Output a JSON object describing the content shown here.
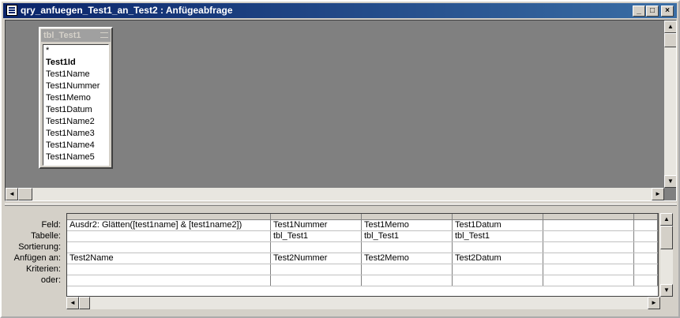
{
  "window": {
    "title": "qry_anfuegen_Test1_an_Test2 : Anfügeabfrage"
  },
  "title_buttons": {
    "minimize": "_",
    "maximize": "□",
    "close": "×"
  },
  "field_list": {
    "table_name": "tbl_Test1",
    "fields": [
      {
        "name": "*",
        "key": false
      },
      {
        "name": "Test1Id",
        "key": true
      },
      {
        "name": "Test1Name",
        "key": false
      },
      {
        "name": "Test1Nummer",
        "key": false
      },
      {
        "name": "Test1Memo",
        "key": false
      },
      {
        "name": "Test1Datum",
        "key": false
      },
      {
        "name": "Test1Name2",
        "key": false
      },
      {
        "name": "Test1Name3",
        "key": false
      },
      {
        "name": "Test1Name4",
        "key": false
      },
      {
        "name": "Test1Name5",
        "key": false
      }
    ]
  },
  "design_grid": {
    "row_labels": [
      "Feld:",
      "Tabelle:",
      "Sortierung:",
      "Anfügen an:",
      "Kriterien:",
      "oder:"
    ],
    "columns": [
      {
        "feld": "Ausdr2: Glätten([test1name] & [test1name2])",
        "tabelle": "",
        "sortierung": "",
        "anfuegen_an": "Test2Name",
        "kriterien": "",
        "oder": ""
      },
      {
        "feld": "Test1Nummer",
        "tabelle": "tbl_Test1",
        "sortierung": "",
        "anfuegen_an": "Test2Nummer",
        "kriterien": "",
        "oder": ""
      },
      {
        "feld": "Test1Memo",
        "tabelle": "tbl_Test1",
        "sortierung": "",
        "anfuegen_an": "Test2Memo",
        "kriterien": "",
        "oder": ""
      },
      {
        "feld": "Test1Datum",
        "tabelle": "tbl_Test1",
        "sortierung": "",
        "anfuegen_an": "Test2Datum",
        "kriterien": "",
        "oder": ""
      },
      {
        "feld": "",
        "tabelle": "",
        "sortierung": "",
        "anfuegen_an": "",
        "kriterien": "",
        "oder": ""
      },
      {
        "feld": "",
        "tabelle": "",
        "sortierung": "",
        "anfuegen_an": "",
        "kriterien": "",
        "oder": ""
      }
    ]
  },
  "icons": {
    "app": "query-window-icon",
    "arrow_up": "▲",
    "arrow_down": "▼",
    "arrow_left": "◄",
    "arrow_right": "►"
  },
  "colors": {
    "title_start": "#0a246a",
    "title_end": "#3a6ea5",
    "workspace": "#808080",
    "face": "#d4d0c8"
  }
}
